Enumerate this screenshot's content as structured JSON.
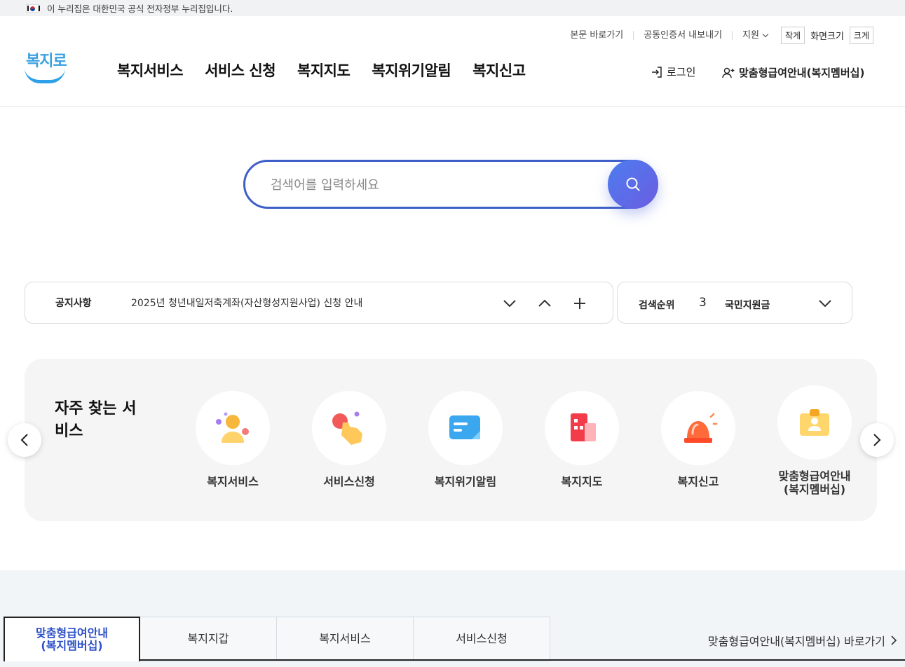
{
  "gov_banner": {
    "text": "이 누리집은 대한민국 공식 전자정부 누리집입니다."
  },
  "util": {
    "skip": "본문 바로가기",
    "cert": "공동인증서 내보내기",
    "support": "지원",
    "small": "작게",
    "font_size": "화면크기",
    "large": "크게"
  },
  "logo": {
    "text": "복지로"
  },
  "gnb": [
    "복지서비스",
    "서비스 신청",
    "복지지도",
    "복지위기알림",
    "복지신고"
  ],
  "login": "로그인",
  "member": "맞춤형급여안내(복지멤버십)",
  "search": {
    "placeholder": "검색어를 입력하세요"
  },
  "notice": {
    "label": "공지사항",
    "text": "2025년 청년내일저축계좌(자산형성지원사업) 신청 안내"
  },
  "rank": {
    "label": "검색순위",
    "num": "3",
    "keyword": "국민지원금"
  },
  "frequent": {
    "title": "자주 찾는 서비스",
    "items": [
      {
        "label": "복지서비스",
        "icon": "person-icon"
      },
      {
        "label": "서비스신청",
        "icon": "hand-tap-icon"
      },
      {
        "label": "복지위기알림",
        "icon": "message-icon"
      },
      {
        "label": "복지지도",
        "icon": "building-icon"
      },
      {
        "label": "복지신고",
        "icon": "siren-icon"
      },
      {
        "label": "맞춤형급여안내\n(복지멤버십)",
        "icon": "id-card-icon"
      }
    ]
  },
  "tabs": [
    {
      "label": "맞춤형급여안내\n(복지멤버십)"
    },
    {
      "label": "복지지갑"
    },
    {
      "label": "복지서비스"
    },
    {
      "label": "서비스신청"
    }
  ],
  "shortcut": "맞춤형급여안내(복지멤버십) 바로가기"
}
